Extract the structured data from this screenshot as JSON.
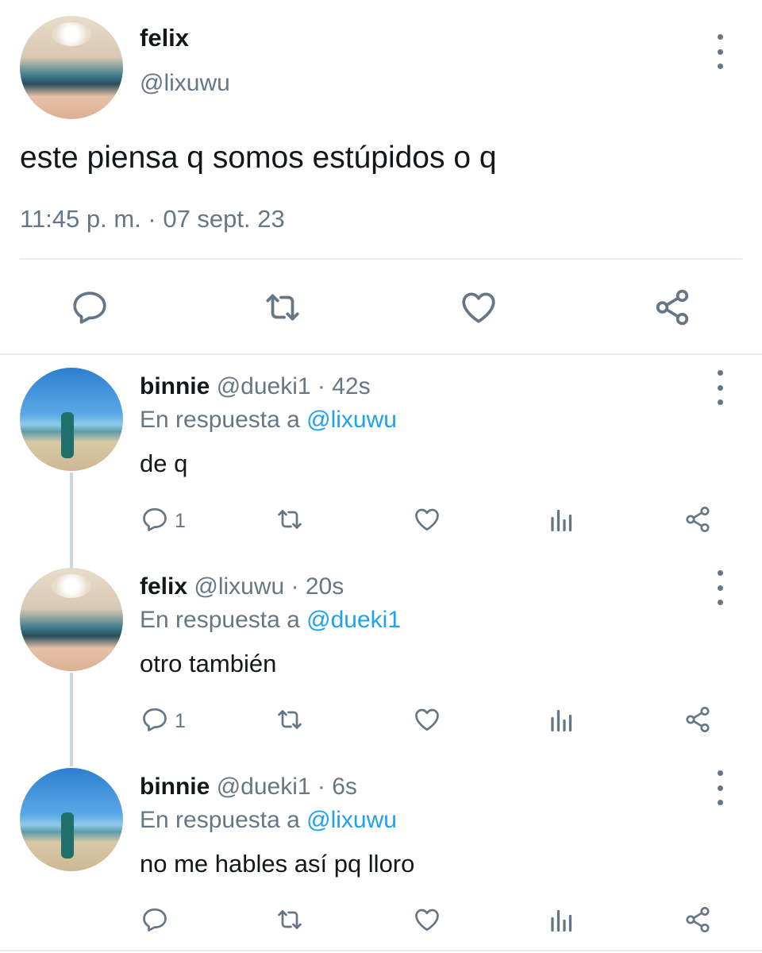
{
  "main_tweet": {
    "display_name": "felix",
    "handle": "@lixuwu",
    "text": "este piensa q somos estúpidos o q",
    "timestamp": "11:45 p. m. · 07 sept. 23"
  },
  "replies": [
    {
      "display_name": "binnie",
      "meta": "@dueki1 · 42s",
      "reply_prefix": "En respuesta a",
      "reply_to": "@lixuwu",
      "text": "de q",
      "reply_count": "1"
    },
    {
      "display_name": "felix",
      "meta": "@lixuwu · 20s",
      "reply_prefix": "En respuesta a",
      "reply_to": "@dueki1",
      "text": "otro también",
      "reply_count": "1"
    },
    {
      "display_name": "binnie",
      "meta": "@dueki1 · 6s",
      "reply_prefix": "En respuesta a",
      "reply_to": "@lixuwu",
      "text": "no me hables así pq lloro",
      "reply_count": ""
    }
  ],
  "icons": [
    "reply-icon",
    "retweet-icon",
    "like-icon",
    "share-icon",
    "analytics-icon",
    "more-icon"
  ],
  "colors": {
    "text": "#14171a",
    "muted": "#657786",
    "link": "#1da1f2",
    "divider": "#e6ecf0"
  }
}
